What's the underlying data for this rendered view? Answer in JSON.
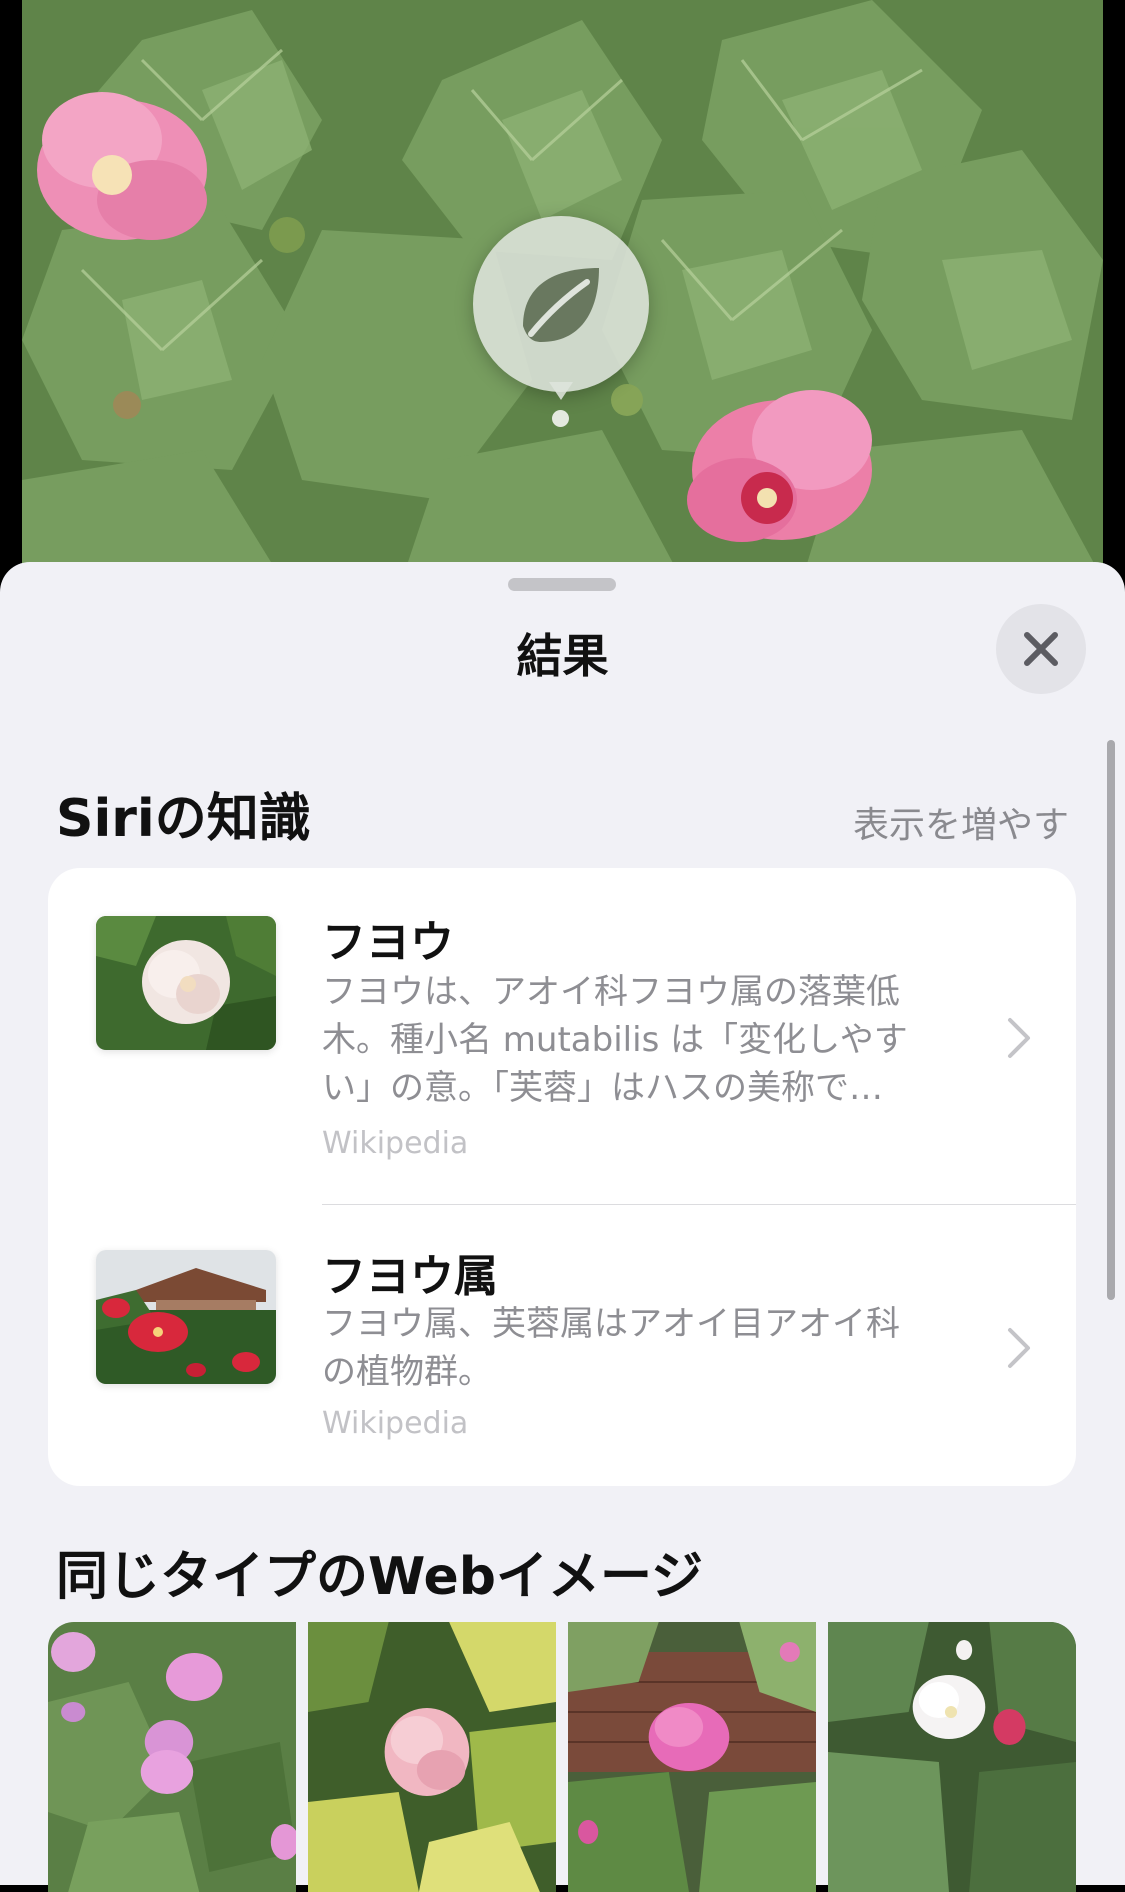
{
  "sheet": {
    "title": "結果",
    "close_icon": "xmark-icon"
  },
  "visual_lookup": {
    "icon": "leaf-icon"
  },
  "siri_knowledge": {
    "heading": "Siriの知識",
    "show_more": "表示を増やす",
    "items": [
      {
        "title": "フヨウ",
        "desc_lines": [
          "フヨウは、アオイ科フヨウ属の落葉低",
          "木。種小名 mutabilis は「変化しやす",
          "い」の意。「芙蓉」はハスの美称で…"
        ],
        "source": "Wikipedia",
        "thumb_icon": "white-hibiscus-photo"
      },
      {
        "title": "フヨウ属",
        "desc_lines": [
          "フヨウ属、芙蓉属はアオイ目アオイ科",
          "の植物群。"
        ],
        "source": "Wikipedia",
        "thumb_icon": "red-hibiscus-pagoda-photo"
      }
    ]
  },
  "web_images": {
    "heading": "同じタイプのWebイメージ",
    "count": 4
  },
  "colors": {
    "sheet_bg": "#f1f1f6",
    "card_bg": "#ffffff",
    "secondary_text": "#8e8e93",
    "source_text": "#c2c2c6",
    "flower_pink": "#ec7fa8"
  }
}
